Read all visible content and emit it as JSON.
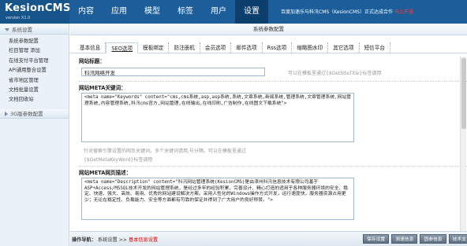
{
  "app": {
    "name": "KesionCMS",
    "version": "version X1.0"
  },
  "nav": [
    "内容",
    "应用",
    "模型",
    "标签",
    "用户",
    "设置"
  ],
  "top_notice": {
    "text": "百度加速乐与科汛CMS（KesionCMS）正式达成合作",
    "highlight": "马上开通"
  },
  "sidebar": {
    "section1": "系统设置",
    "items": [
      {
        "label": "系统参数配置"
      },
      {
        "label": "栏目管理  添加"
      },
      {
        "label": "在线支付平台管理"
      },
      {
        "label": "API通用整合设置"
      },
      {
        "label": "省市地区管理"
      },
      {
        "label": "文档批量设置"
      },
      {
        "label": "文档回收站"
      }
    ],
    "section2": "3G版参数配置"
  },
  "panel": {
    "title": "系统参数配置"
  },
  "tabs": [
    "基本信息",
    "SEO选项",
    "模板绑定",
    "防注册机",
    "会员选项",
    "邮件选项",
    "Rss选项",
    "缩略图水印",
    "其它选项",
    "短信平台"
  ],
  "seo": {
    "title_label": "网站标题：",
    "title_value": "科汛网络开发",
    "title_hint": "可以在模板里通过{$GetSiteTitle}标签调用",
    "keywords_label": "网站META关键词：",
    "keywords_value": "<meta name=\"Keywords\" content=\"cms,cms系统,asp,asp系统,系统,文章系统,新闻系统,管理系统,文章管理系统,网站管理系统,内容管理系统,科汛cms官方,网站管理,在线输出,在线印刷,广告制作,在线图文下载系统\">",
    "keywords_hint1": "针对搜索引擎设置的网页关键词，多个关键词请用,号分隔。可以在模板里通过",
    "keywords_hint2": "{$GetMetaKeyWord}标签调用",
    "desc_label": "网站META网页描述：",
    "desc_value": "<meta name=\"Description\" content=\"科汛网站管理系统(KesionCMS)是由漳州科汛信息技术有限公司基于ASP+Access/MSSQL技术开发的网站管理系统，是经过多年的经验积累，完善设计、精心打造的适用于各种服务器环境的安全、稳定、快速、强大、高效、易用、优秀的网站建设解决方案。采用人性化的Windows操作方式开发，运行速度快，服务器资源占用更少；无论在稳定性、负载能力、安全等方面都有可靠的保证并得到了广大用户的良好称赞。\">"
  },
  "footer": {
    "label": "操作导航：",
    "path1": "系统设置",
    "sep": ">>",
    "path2": "基本信息设置",
    "buttons": [
      "保存设置",
      "测速信息",
      "固参信息",
      "技术支"
    ]
  }
}
